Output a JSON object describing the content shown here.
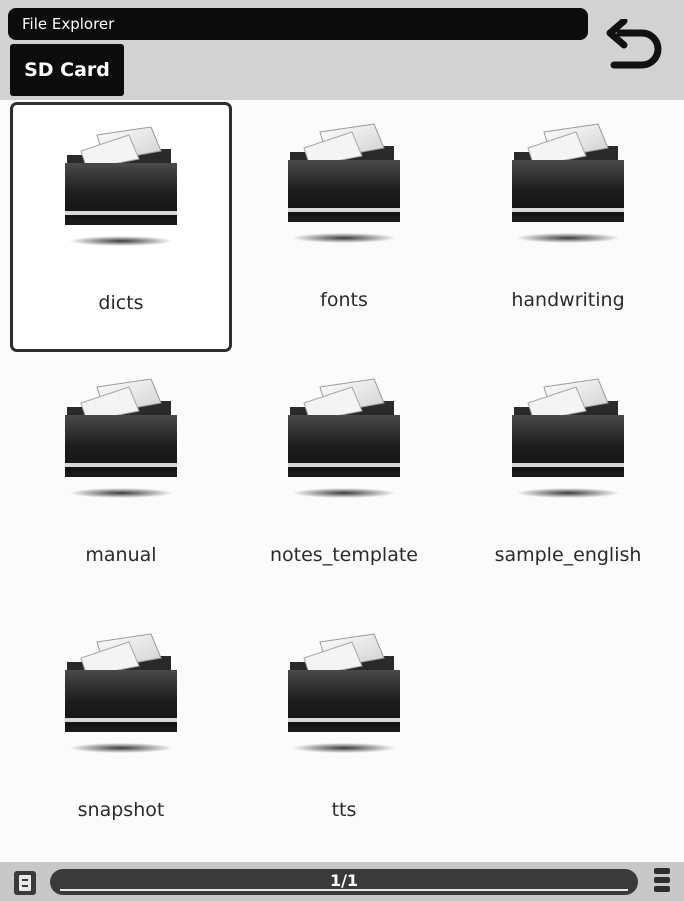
{
  "header": {
    "title": "File Explorer",
    "location": "SD Card",
    "back_icon": "undo-arrow-icon"
  },
  "folders": [
    {
      "name": "dicts",
      "selected": true,
      "icon": "folder-icon"
    },
    {
      "name": "fonts",
      "selected": false,
      "icon": "folder-icon"
    },
    {
      "name": "handwriting",
      "selected": false,
      "icon": "folder-icon"
    },
    {
      "name": "manual",
      "selected": false,
      "icon": "folder-icon"
    },
    {
      "name": "notes_template",
      "selected": false,
      "icon": "folder-icon"
    },
    {
      "name": "sample_english",
      "selected": false,
      "icon": "folder-icon"
    },
    {
      "name": "snapshot",
      "selected": false,
      "icon": "folder-icon"
    },
    {
      "name": "tts",
      "selected": false,
      "icon": "folder-icon"
    }
  ],
  "footer": {
    "page_indicator": "1/1",
    "left_icon": "page-icon",
    "right_icon": "menu-icon"
  },
  "colors": {
    "header_bg": "#d2d2d2",
    "title_bg": "#0c0c0c",
    "folder_body": "#1f1f1f",
    "footer_track": "#3a3a3a"
  }
}
